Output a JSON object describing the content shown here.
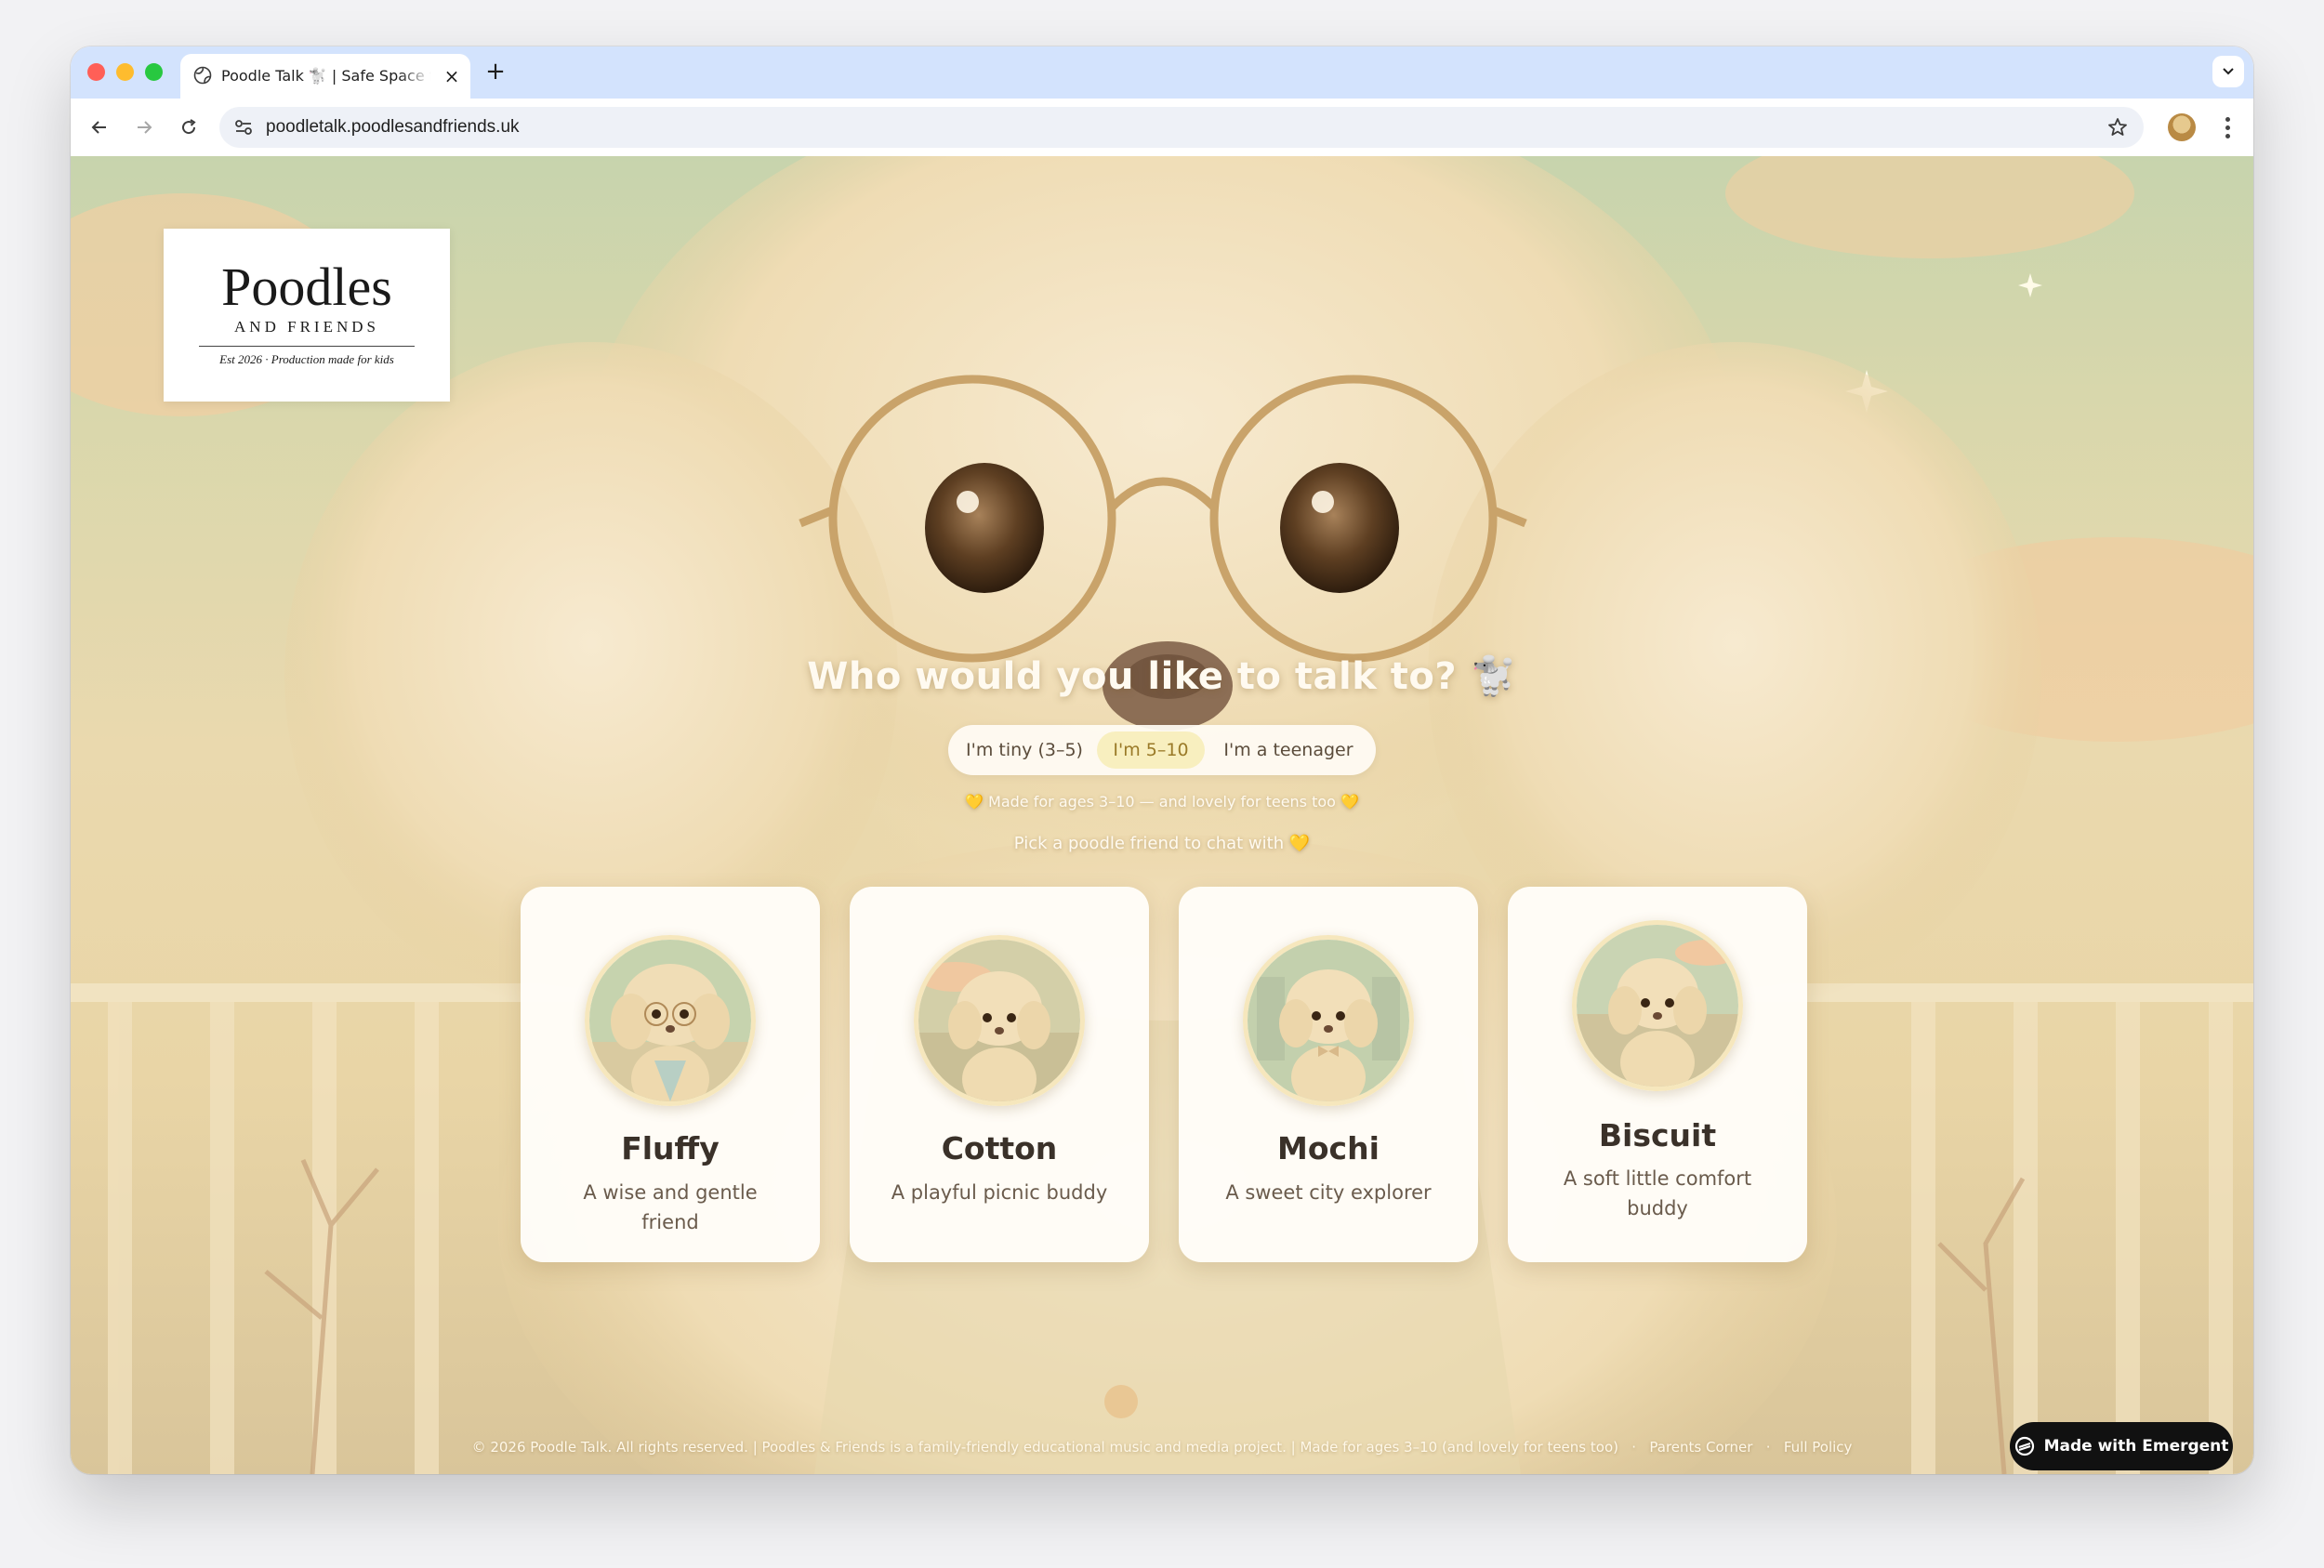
{
  "browser": {
    "tab_title": "Poodle Talk 🐩 | Safe Space for kids",
    "url": "poodletalk.poodlesandfriends.uk",
    "new_tab_label": "+",
    "close_label": "×",
    "tab_menu_label": "⌄"
  },
  "logo": {
    "title": "Poodles",
    "subtitle": "AND FRIENDS",
    "tagline": "Est 2026 · Production made for kids"
  },
  "hero": {
    "headline": "Who would you like to talk to? 🐩",
    "age_options": [
      "I'm tiny (3–5)",
      "I'm 5–10",
      "I'm a teenager"
    ],
    "selected_age_index": 1,
    "age_note": "💛 Made for ages 3–10 — and lovely for teens too 💛",
    "pick_note": "Pick a poodle friend to chat with 💛"
  },
  "characters": [
    {
      "name": "Fluffy",
      "description": "A wise and gentle friend"
    },
    {
      "name": "Cotton",
      "description": "A playful picnic buddy"
    },
    {
      "name": "Mochi",
      "description": "A sweet city explorer"
    },
    {
      "name": "Biscuit",
      "description": "A soft little comfort buddy"
    }
  ],
  "footer": {
    "text": "© 2026 Poodle Talk. All rights reserved. | Poodles & Friends is a family-friendly educational music and media project. | Made for ages 3–10 (and lovely for teens too)",
    "links": [
      "Parents Corner",
      "Full Policy"
    ],
    "separator": "·"
  },
  "badge": {
    "label": "Made with Emergent"
  },
  "colors": {
    "accent_gold": "#9a7a28",
    "active_pill": "#f8efbf",
    "card_bg": "#fffdf9",
    "text_dark": "#3a3129"
  }
}
